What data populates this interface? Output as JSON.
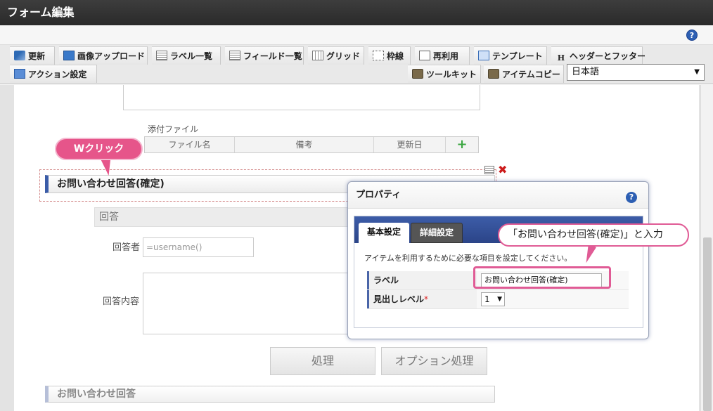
{
  "window": {
    "title": "フォーム編集"
  },
  "toolbar": {
    "row1": [
      {
        "label": "更新",
        "icon": "update-icon"
      },
      {
        "label": "画像アップロード",
        "icon": "image-upload-icon"
      },
      {
        "label": "ラベル一覧",
        "icon": "list-icon"
      },
      {
        "label": "フィールド一覧",
        "icon": "list-icon"
      },
      {
        "label": "グリッド",
        "icon": "grid-icon"
      },
      {
        "label": "枠線",
        "icon": "frame-icon"
      },
      {
        "label": "再利用",
        "icon": "reuse-icon"
      },
      {
        "label": "テンプレート",
        "icon": "template-icon"
      },
      {
        "label": "ヘッダーとフッター",
        "icon": "header-icon"
      }
    ],
    "action_label": "アクション設定",
    "toolkit_label": "ツールキット",
    "itemcopy_label": "アイテムコピー",
    "language_value": "日本語"
  },
  "form": {
    "attach_label": "添付ファイル",
    "attach_columns": [
      "ファイル名",
      "備考",
      "更新日"
    ],
    "heading_selected": "お問い合わせ回答(確定)",
    "section_answer": "回答",
    "responder_label": "回答者",
    "responder_value": "=username()",
    "content_label": "回答内容",
    "btn_process": "処理",
    "btn_option": "オプション処理",
    "heading_bottom": "お問い合わせ回答"
  },
  "dialog": {
    "title": "プロパティ",
    "tabs": [
      "基本設定",
      "詳細設定"
    ],
    "description": "アイテムを利用するために必要な項目を設定してください。",
    "rows": [
      {
        "key": "ラベル",
        "value": "お問い合わせ回答(確定)"
      },
      {
        "key": "見出しレベル",
        "required": "*",
        "value": "1"
      }
    ]
  },
  "annotations": {
    "wclick": "Wクリック",
    "instruction": "「お問い合わせ回答(確定)」と入力"
  },
  "colors": {
    "accent_pink": "#e05b95",
    "dialog_tab_blue": "#2b4488",
    "titlebar": "#2a2a2a"
  }
}
